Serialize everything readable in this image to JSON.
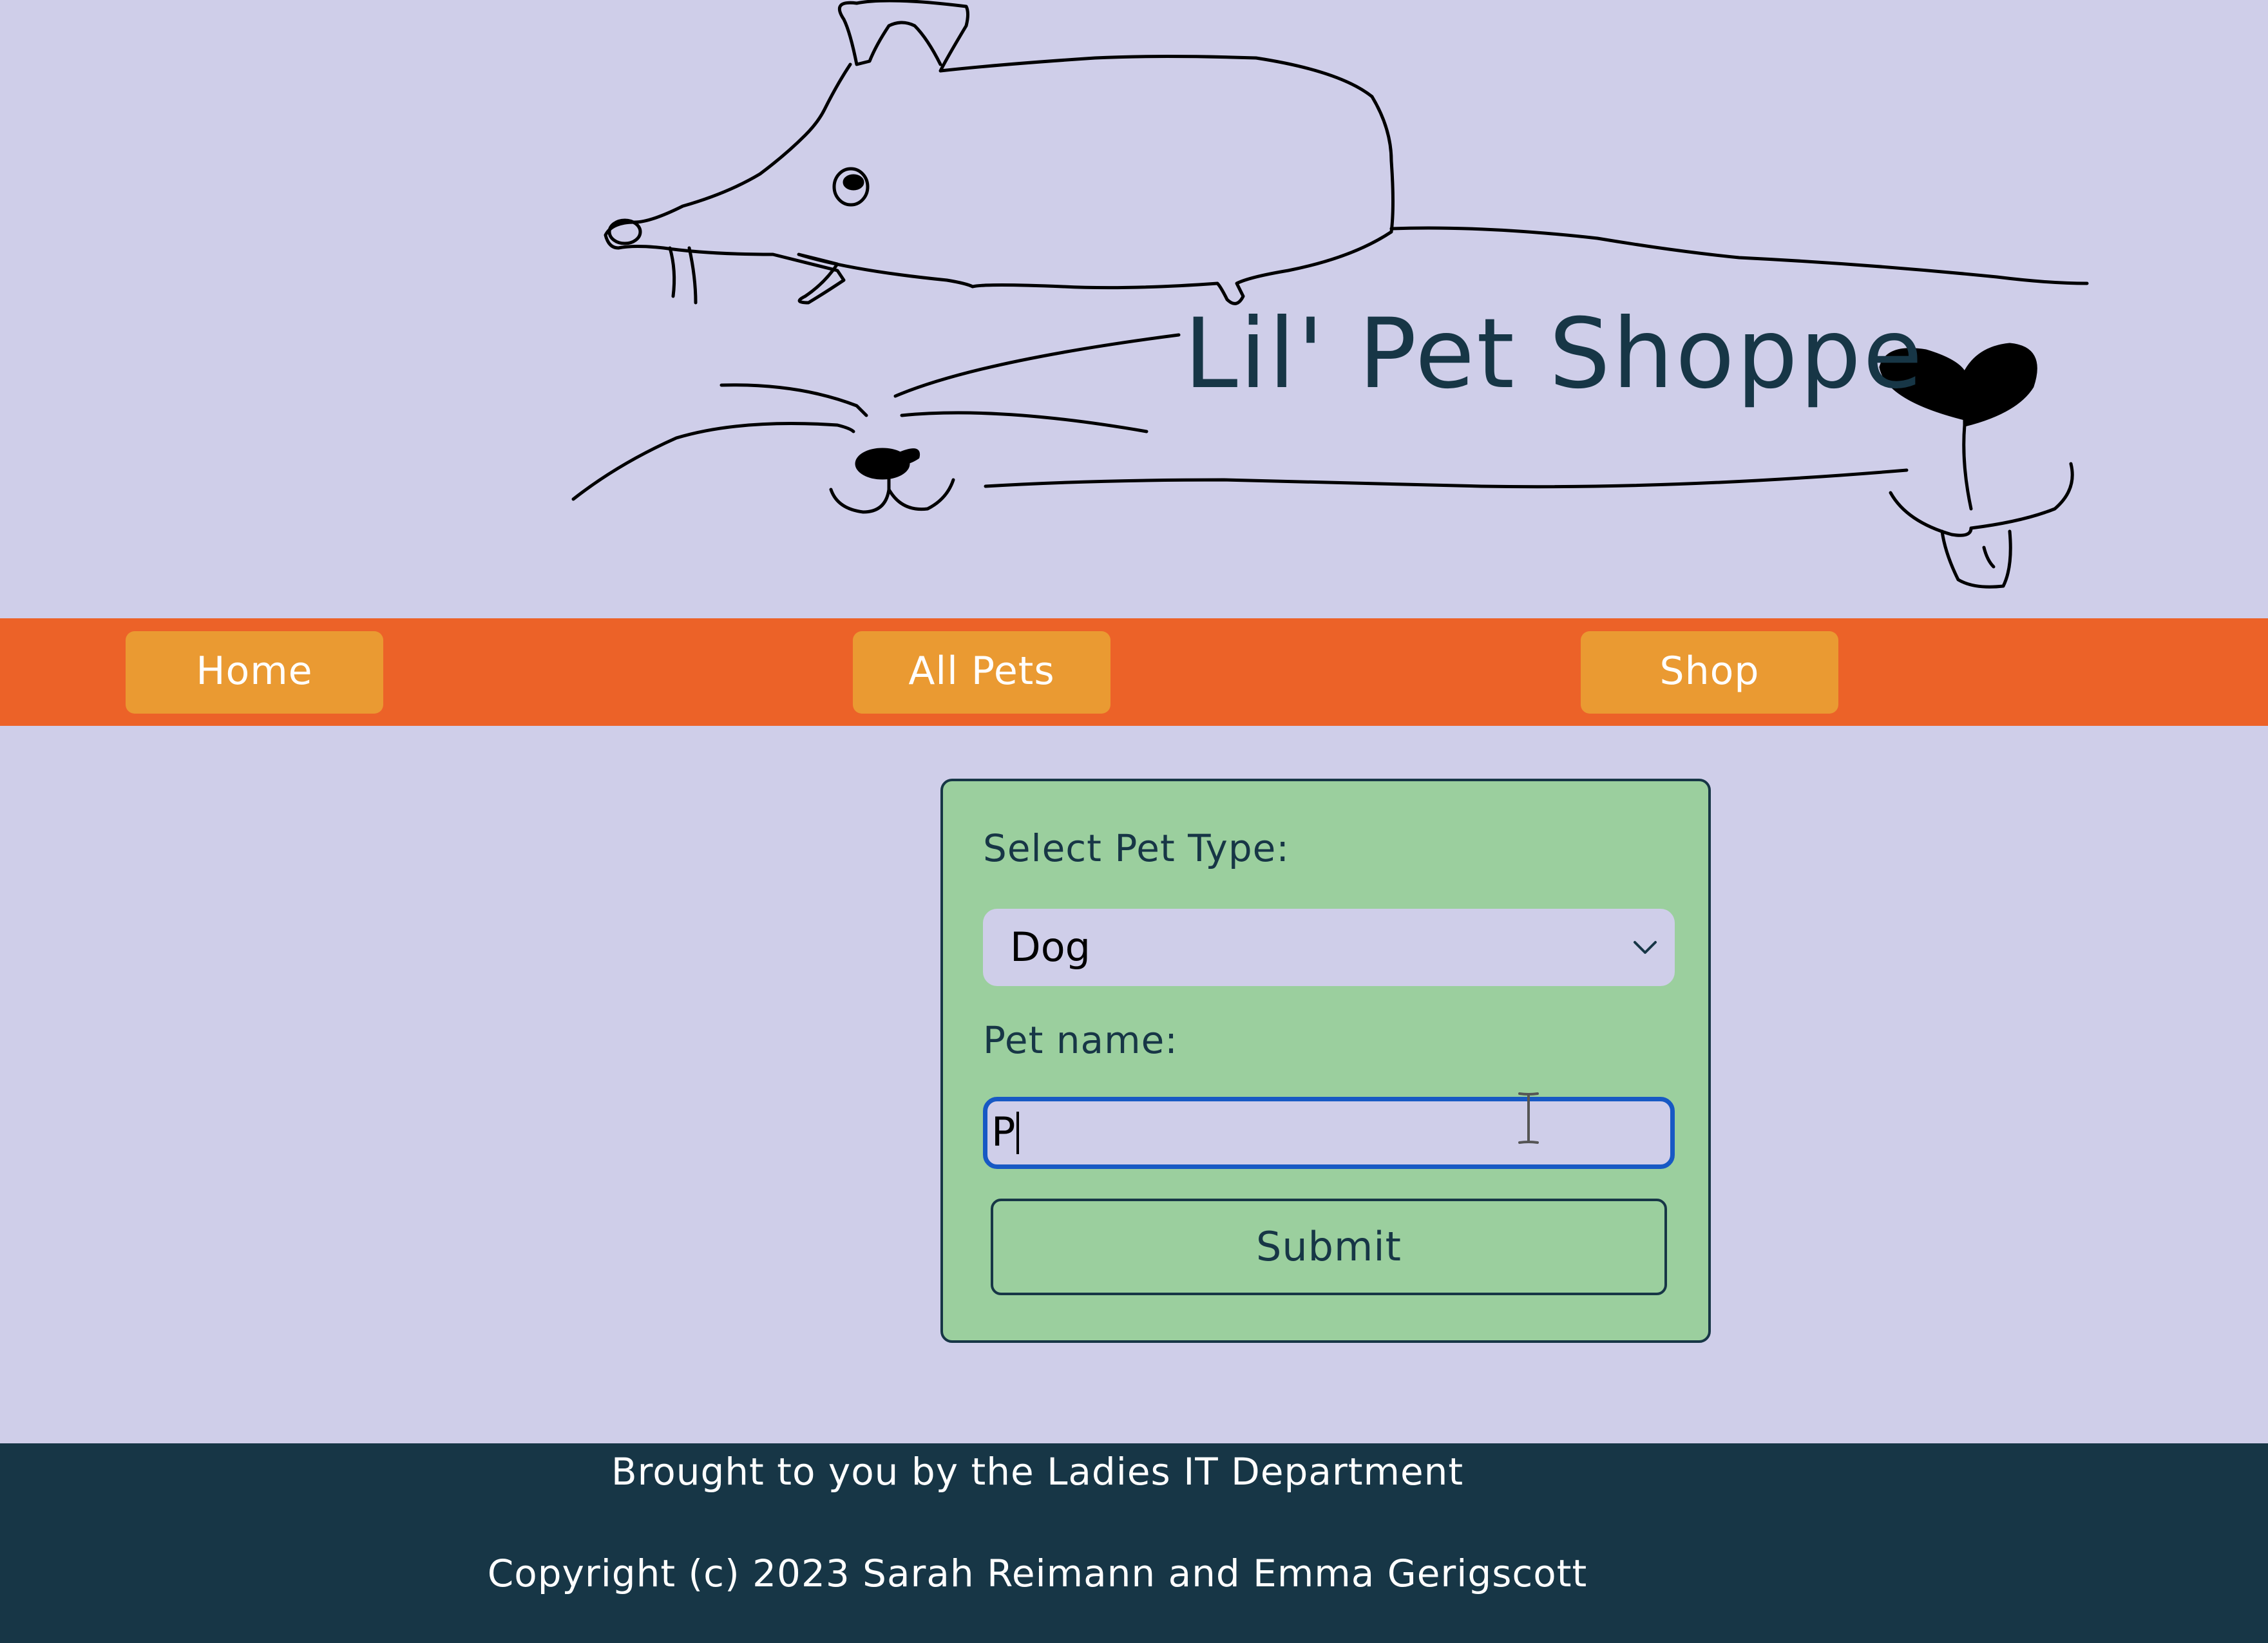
{
  "header": {
    "title": "Lil' Pet Shoppe",
    "title_color": "#173646"
  },
  "nav": {
    "items": [
      {
        "label": "Home"
      },
      {
        "label": "All Pets"
      },
      {
        "label": "Shop"
      }
    ],
    "bar_color": "#ec6228",
    "button_color": "#ea9a32"
  },
  "form": {
    "pet_type_label": "Select Pet Type:",
    "pet_type_selected": "Dog",
    "pet_name_label": "Pet name:",
    "pet_name_value": "P",
    "submit_label": "Submit",
    "card_color": "#9bcf9e",
    "focus_color": "#1759c4"
  },
  "footer": {
    "line1": "Brought to you by the Ladies IT Department",
    "line2": "Copyright (c) 2023 Sarah Reimann and Emma Gerigscott",
    "bg_color": "#173646"
  },
  "page": {
    "bg_color": "#cfcee9"
  }
}
